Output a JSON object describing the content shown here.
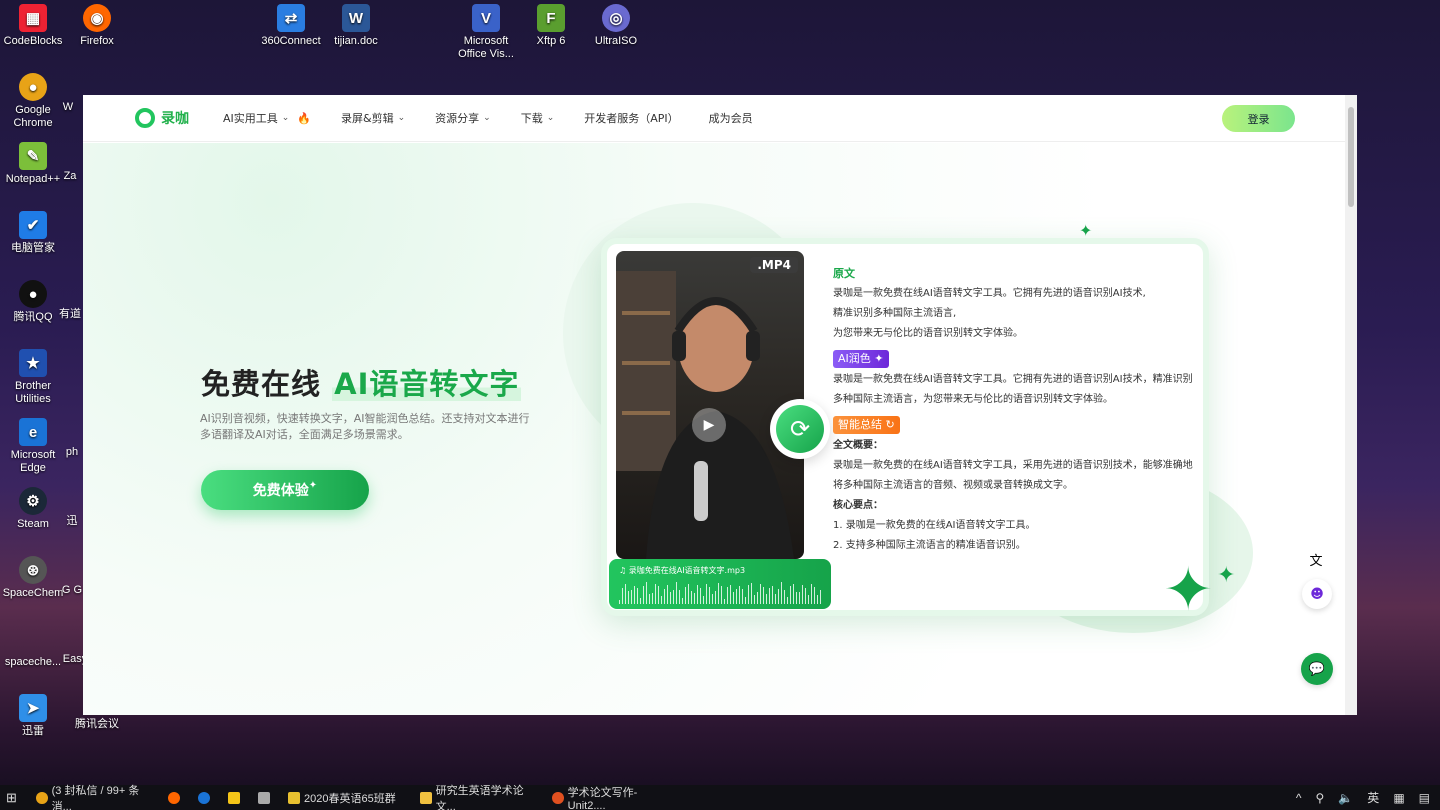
{
  "desktop": {
    "icons": [
      {
        "label": "CodeBlocks",
        "color": "#e23"
      },
      {
        "label": "Firefox",
        "color": "#f60"
      },
      {
        "label": "360Connect",
        "color": "#2a7de1"
      },
      {
        "label": "tijian.doc",
        "color": "#2b5797"
      },
      {
        "label": "Microsoft Office Vis...",
        "color": "#3a62c9"
      },
      {
        "label": "Xftp 6",
        "color": "#5a9e2f"
      },
      {
        "label": "UltraISO",
        "color": "#6a6ad0"
      },
      {
        "label": "Google Chrome",
        "color": "#e8a317"
      },
      {
        "label": "Notepad++",
        "color": "#7cbf3a"
      },
      {
        "label": "电脑管家",
        "color": "#1f7ce6"
      },
      {
        "label": "腾讯QQ",
        "color": "#111"
      },
      {
        "label": "Brother Utilities",
        "color": "#2050b0"
      },
      {
        "label": "Microsoft Edge",
        "color": "#1a73d6"
      },
      {
        "label": "Steam",
        "color": "#1b2838"
      },
      {
        "label": "SpaceChem",
        "color": "#555"
      },
      {
        "label": "spaceche...",
        "color": "#444"
      },
      {
        "label": "迅雷",
        "color": "#2f8fe8"
      },
      {
        "label": "腾讯会议",
        "color": "#2b7df0"
      }
    ],
    "partial_labels": [
      "W",
      "Za",
      "有道",
      "ph",
      "迅",
      "G G",
      "Easy"
    ]
  },
  "site": {
    "logo_text": "录咖",
    "nav": [
      {
        "label": "AI实用工具",
        "has_chevron": true,
        "hot": true
      },
      {
        "label": "录屏&剪辑",
        "has_chevron": true
      },
      {
        "label": "资源分享",
        "has_chevron": true
      },
      {
        "label": "下载",
        "has_chevron": true
      },
      {
        "label": "开发者服务（API）",
        "has_chevron": false
      },
      {
        "label": "成为会员",
        "has_chevron": false
      }
    ],
    "login_label": "登录",
    "hero": {
      "title_plain": "免费在线",
      "title_highlight": "AI语音转文字",
      "subtitle": "AI识别音视频，快速转换文字，AI智能润色总结。还支持对文本进行多语翻译及AI对话，全面满足多场景需求。",
      "cta_label": "免费体验"
    },
    "demo": {
      "video_badge": ".MP4",
      "audio_file": "录咖免费在线AI语音转文字.mp3",
      "original_label": "原文",
      "original_text": [
        "录咖是一款免费在线AI语音转文字工具。它拥有先进的语音识别AI技术,",
        "精准识别多种国际主流语言,",
        "为您带来无与伦比的语音识别转文字体验。"
      ],
      "polish_badge": "AI润色",
      "polish_text": "录咖是一款免费在线AI语音转文字工具。它拥有先进的语音识别AI技术，精准识别多种国际主流语言，为您带来无与伦比的语音识别转文字体验。",
      "summary_badge": "智能总结",
      "overview_label": "全文概要：",
      "overview_text": "录咖是一款免费的在线AI语音转文字工具，采用先进的语音识别技术，能够准确地将多种国际主流语言的音频、视频或录音转换成文字。",
      "key_points_label": "核心要点：",
      "key_points": [
        "1. 录咖是一款免费的在线AI语音转文字工具。",
        "2. 支持多种国际主流语言的精准语音识别。"
      ]
    }
  },
  "taskbar": {
    "items": [
      {
        "label": "(3 封私信 / 99+ 条消...",
        "color": "#e8a317"
      },
      {
        "label": "",
        "color": "#f60"
      },
      {
        "label": "",
        "color": "#1a73d6"
      },
      {
        "label": "",
        "color": "#f5c518"
      },
      {
        "label": "",
        "color": "#aaa"
      },
      {
        "label": "2020春英语65班群",
        "color": "#e8c030"
      },
      {
        "label": "研究生英语学术论文...",
        "color": "#f0c040"
      },
      {
        "label": "学术论文写作-Unit2....",
        "color": "#e05020"
      }
    ],
    "tray": {
      "ime": "英",
      "caret": "^"
    }
  }
}
